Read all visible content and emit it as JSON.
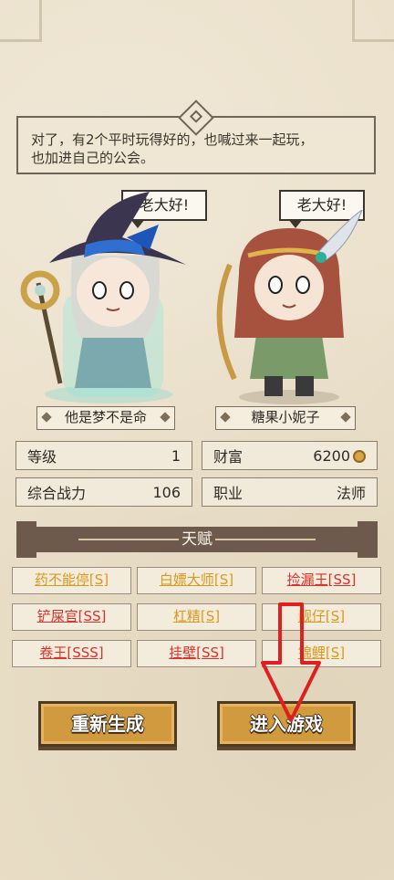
{
  "dialog": {
    "text": "对了，有2个平时玩得好的，也喊过来一起玩，\n也加进自己的公会。"
  },
  "characters": [
    {
      "speech": "老大好!",
      "name": "他是梦不是命"
    },
    {
      "speech": "老大好!",
      "name": "糖果小妮子"
    }
  ],
  "stats": {
    "level_label": "等级",
    "level_value": "1",
    "wealth_label": "财富",
    "wealth_value": "6200",
    "power_label": "综合战力",
    "power_value": "106",
    "job_label": "职业",
    "job_value": "法师"
  },
  "talent_title": "天赋",
  "talents": [
    {
      "label": "药不能停[S]",
      "color": "#d89a1e"
    },
    {
      "label": "白嫖大师[S]",
      "color": "#d89a1e"
    },
    {
      "label": "捡漏王[SS]",
      "color": "#d8322d"
    },
    {
      "label": "铲屎官[SS]",
      "color": "#d8322d"
    },
    {
      "label": "杠精[S]",
      "color": "#d89a1e"
    },
    {
      "label": "靓仔[S]",
      "color": "#d89a1e"
    },
    {
      "label": "卷王[SSS]",
      "color": "#d8322d"
    },
    {
      "label": "挂壁[SS]",
      "color": "#d8322d"
    },
    {
      "label": "锦鲤[S]",
      "color": "#d89a1e"
    }
  ],
  "buttons": {
    "regenerate": "重新生成",
    "enter_game": "进入游戏"
  },
  "colors": {
    "accent": "#d19a3f",
    "annotation_arrow": "#e02020"
  }
}
